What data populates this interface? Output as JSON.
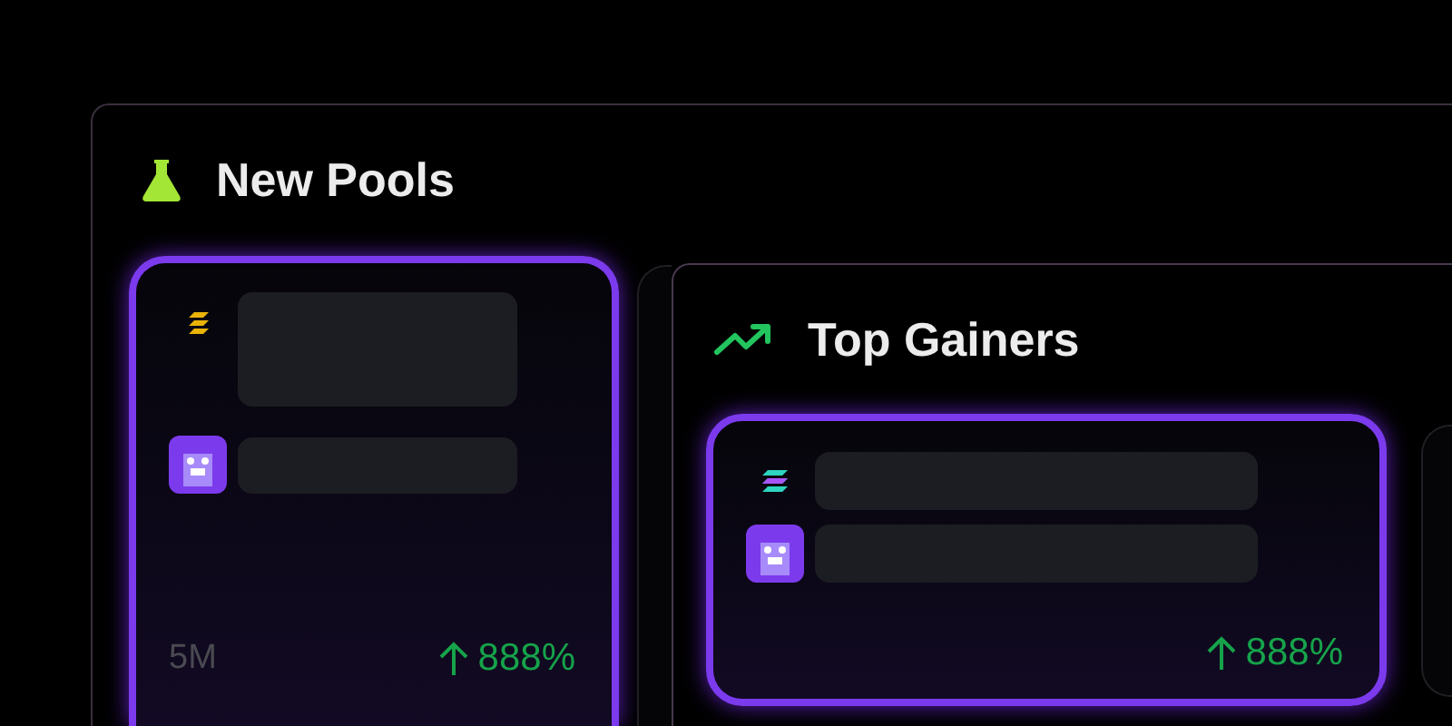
{
  "panels": [
    {
      "title": "New Pools",
      "cards": [
        {
          "selected": true,
          "volume": "5M",
          "change": "888%"
        },
        {
          "selected": false
        }
      ]
    },
    {
      "title": "Top Gainers",
      "cards": [
        {
          "selected": true,
          "change": "888%"
        },
        {
          "selected": false
        }
      ]
    }
  ]
}
